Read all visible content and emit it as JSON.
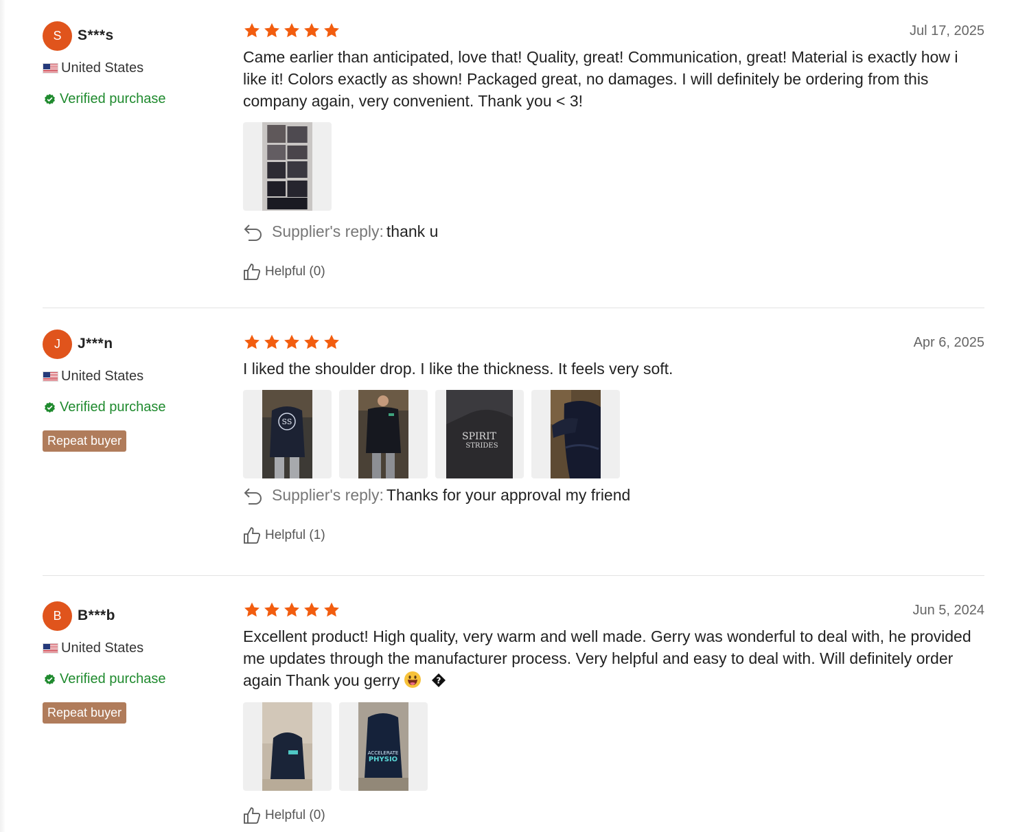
{
  "reviews": [
    {
      "avatar_letter": "S",
      "name": "S***s",
      "country": "United States",
      "verified_label": "Verified purchase",
      "repeat_label": null,
      "rating": 5,
      "date": "Jul 17, 2025",
      "text": "Came earlier than anticipated, love that! Quality, great! Communication, great! Material is exactly how i like it! Colors exactly as shown! Packaged great, no damages. I will definitely be ordering from this company again, very convenient. Thank you < 3!",
      "photo_count": 1,
      "reply_label": "Supplier's reply:",
      "reply_text": "thank u",
      "helpful_label": "Helpful (0)"
    },
    {
      "avatar_letter": "J",
      "name": "J***n",
      "country": "United States",
      "verified_label": "Verified purchase",
      "repeat_label": "Repeat buyer",
      "rating": 5,
      "date": "Apr 6, 2025",
      "text": "I liked the shoulder drop. I like the thickness. It feels very soft.",
      "photo_count": 4,
      "reply_label": "Supplier's reply:",
      "reply_text": "Thanks for your approval my friend",
      "helpful_label": "Helpful (1)"
    },
    {
      "avatar_letter": "B",
      "name": "B***b",
      "country": "United States",
      "verified_label": "Verified purchase",
      "repeat_label": "Repeat buyer",
      "rating": 5,
      "date": "Jun 5, 2024",
      "text": "Excellent product! High quality, very warm and well made. Gerry was wonderful to deal with, he provided me updates through the manufacturer process. Very helpful and easy to deal with. Will definitely order again Thank you gerry",
      "photo_count": 2,
      "reply_label": null,
      "reply_text": null,
      "helpful_label": "Helpful (0)"
    }
  ],
  "colors": {
    "star": "#f25d0f",
    "avatar": "#e0541c",
    "verified": "#1f8a2e",
    "repeat_badge": "#b07c5b"
  },
  "icons": [
    "us-flag-icon",
    "verified-check-icon",
    "star-icon",
    "reply-arrow-icon",
    "thumbs-up-icon",
    "grinning-face-emoji",
    "replacement-character-icon"
  ]
}
